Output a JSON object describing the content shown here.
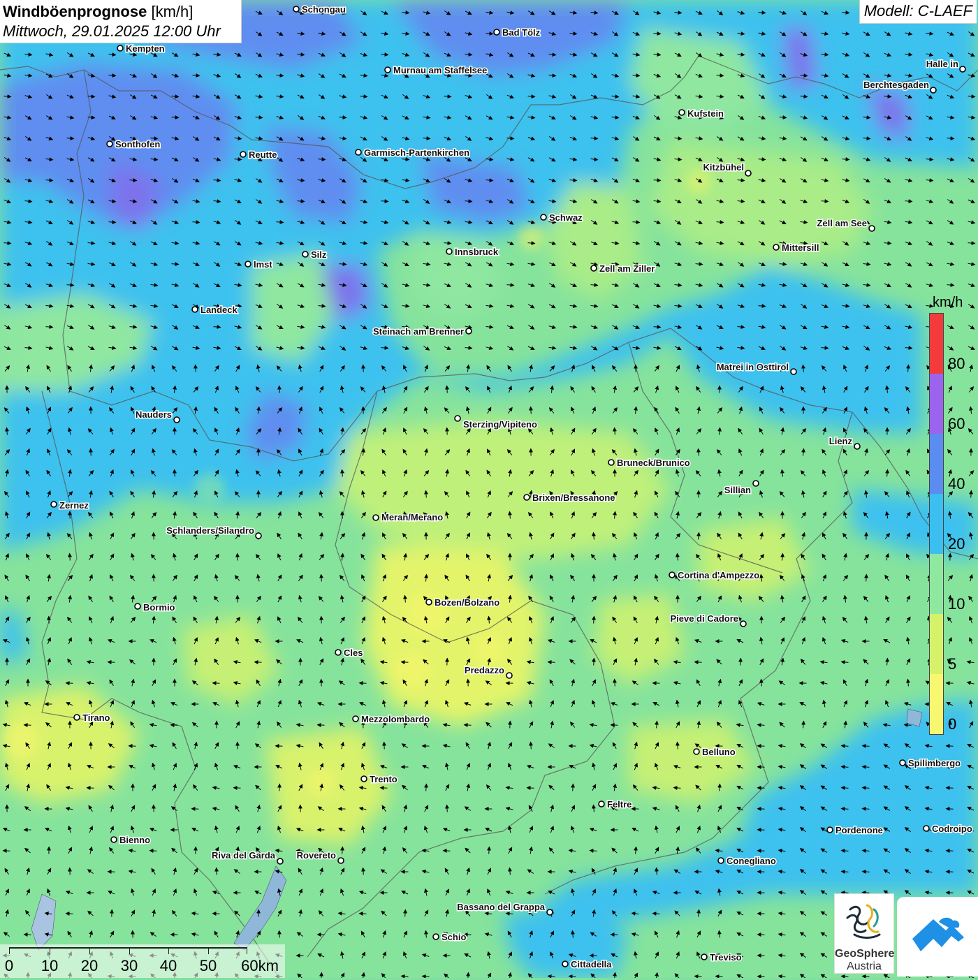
{
  "title": {
    "main": "Windböenprognose",
    "unit": "[km/h]",
    "datetime": "Mittwoch, 29.01.2025 12:00 Uhr"
  },
  "model": "Modell: C-LAEF",
  "legend": {
    "unit": "km/h",
    "labels": [
      "80",
      "60",
      "40",
      "20",
      "10",
      "5",
      "0"
    ],
    "colors": [
      "#f43b3b",
      "#9b63ee",
      "#5a8cf2",
      "#3bbef0",
      "#8fe8a0",
      "#d5f26a",
      "#f8f870"
    ]
  },
  "scalebar": {
    "labels": [
      "0",
      "10",
      "20",
      "30",
      "40",
      "50",
      "60km"
    ]
  },
  "logo": {
    "name1": "GeoSphere",
    "name2": "Austria"
  },
  "cities": [
    {
      "name": "Schongau"
    },
    {
      "name": "Bad Tölz"
    },
    {
      "name": "Kempten"
    },
    {
      "name": "Murnau am Staffelsee"
    },
    {
      "name": "Halle in"
    },
    {
      "name": "Berchtesgaden"
    },
    {
      "name": "Kufstein"
    },
    {
      "name": "Sonthofen"
    },
    {
      "name": "Reutte"
    },
    {
      "name": "Garmisch-Partenkirchen"
    },
    {
      "name": "Kitzbühel"
    },
    {
      "name": "Schwaz"
    },
    {
      "name": "Zell am See"
    },
    {
      "name": "Mittersill"
    },
    {
      "name": "Innsbruck"
    },
    {
      "name": "Silz"
    },
    {
      "name": "Imst"
    },
    {
      "name": "Zell am Ziller"
    },
    {
      "name": "Landeck"
    },
    {
      "name": "Steinach am Brenner"
    },
    {
      "name": "Matrei in Osttirol"
    },
    {
      "name": "Nauders"
    },
    {
      "name": "Sterzing/Vipiteno"
    },
    {
      "name": "Lienz"
    },
    {
      "name": "Bruneck/Brunico"
    },
    {
      "name": "Sillian"
    },
    {
      "name": "Brixen/Bressanone"
    },
    {
      "name": "Zernez"
    },
    {
      "name": "Meran/Merano"
    },
    {
      "name": "Schlanders/Silandro"
    },
    {
      "name": "Cortina d'Ampezzo"
    },
    {
      "name": "Bozen/Bolzano"
    },
    {
      "name": "Bormio"
    },
    {
      "name": "Pieve di Cadore"
    },
    {
      "name": "Cles"
    },
    {
      "name": "Predazzo"
    },
    {
      "name": "Tirano"
    },
    {
      "name": "Mezzolombardo"
    },
    {
      "name": "Belluno"
    },
    {
      "name": "Spilimbergo"
    },
    {
      "name": "Trento"
    },
    {
      "name": "Feltre"
    },
    {
      "name": "Pordenone"
    },
    {
      "name": "Codroipo"
    },
    {
      "name": "Bienno"
    },
    {
      "name": "Riva del Garda"
    },
    {
      "name": "Rovereto"
    },
    {
      "name": "Conegliano"
    },
    {
      "name": "Bassano del Grappa"
    },
    {
      "name": "Schio"
    },
    {
      "name": "Treviso"
    },
    {
      "name": "Cittadella"
    }
  ]
}
